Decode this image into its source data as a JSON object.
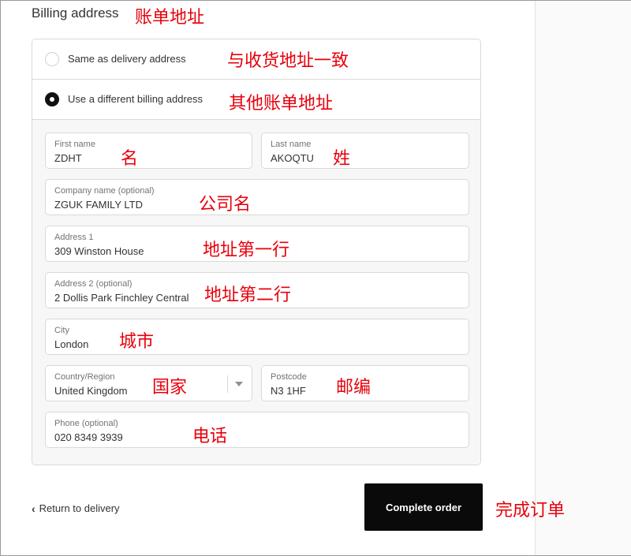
{
  "billing": {
    "title": "Billing address",
    "options": [
      {
        "label": "Same as delivery address",
        "selected": false
      },
      {
        "label": "Use a different billing address",
        "selected": true
      }
    ]
  },
  "form": {
    "first_name": {
      "label": "First name",
      "value": "ZDHT"
    },
    "last_name": {
      "label": "Last name",
      "value": "AKOQTU"
    },
    "company": {
      "label": "Company name (optional)",
      "value": "ZGUK FAMILY LTD"
    },
    "address1": {
      "label": "Address 1",
      "value": "309 Winston House"
    },
    "address2": {
      "label": "Address 2 (optional)",
      "value": "2 Dollis Park Finchley Central"
    },
    "city": {
      "label": "City",
      "value": "London"
    },
    "country": {
      "label": "Country/Region",
      "value": "United Kingdom"
    },
    "postcode": {
      "label": "Postcode",
      "value": "N3 1HF"
    },
    "phone": {
      "label": "Phone (optional)",
      "value": "020 8349 3939"
    }
  },
  "footer": {
    "back_label": "Return to delivery",
    "complete_label": "Complete order"
  },
  "annotations": {
    "billing_address": "账单地址",
    "same_as_delivery": "与收货地址一致",
    "different_billing": "其他账单地址",
    "first_name": "名",
    "last_name": "姓",
    "company": "公司名",
    "address1": "地址第一行",
    "address2": "地址第二行",
    "city": "城市",
    "country": "国家",
    "postcode": "邮编",
    "phone": "电话",
    "complete_order": "完成订单"
  },
  "colors": {
    "annotation": "#e8000b",
    "button_bg": "#0a0a0a",
    "border": "#d9d9d9"
  }
}
